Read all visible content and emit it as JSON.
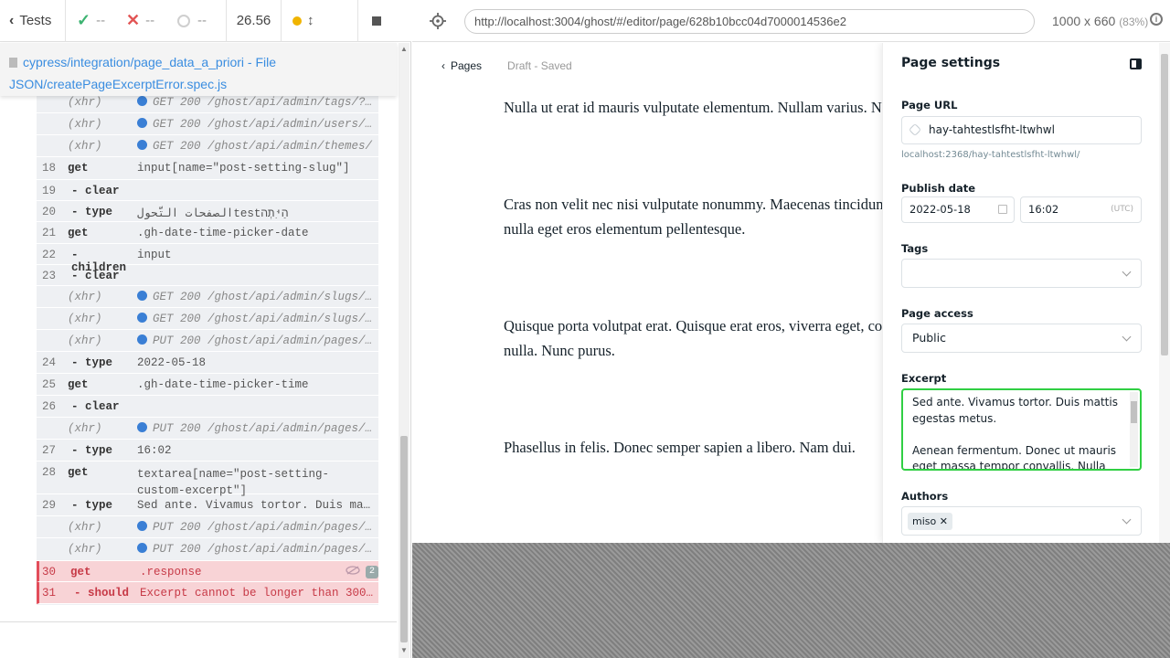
{
  "runner": {
    "tests_label": "Tests",
    "passed": "--",
    "failed": "--",
    "pending": "--",
    "duration": "26.56",
    "spec_path_1": "cypress/integration/page_data_a_priori",
    "spec_sep": " - ",
    "spec_word": "File",
    "spec_path_2": "JSON/createPageExcerptError.spec.js",
    "commands": [
      {
        "type": "xhr",
        "num": "",
        "cmd": "(xhr)",
        "msg": "GET 200 /ghost/api/admin/tags/?..."
      },
      {
        "type": "xhr",
        "num": "",
        "cmd": "(xhr)",
        "msg": "GET 200 /ghost/api/admin/users/..."
      },
      {
        "type": "xhr",
        "num": "",
        "cmd": "(xhr)",
        "msg": "GET 200 /ghost/api/admin/themes/"
      },
      {
        "type": "cmd",
        "num": "18",
        "cmd": "get",
        "msg": "input[name=\"post-setting-slug\"]"
      },
      {
        "type": "child",
        "num": "19",
        "cmd": "- clear",
        "msg": ""
      },
      {
        "type": "child",
        "num": "20",
        "cmd": "- type",
        "msg": "الصفحات التّحولtestהַיִּתְה"
      },
      {
        "type": "cmd",
        "num": "21",
        "cmd": "get",
        "msg": ".gh-date-time-picker-date"
      },
      {
        "type": "child",
        "num": "22",
        "cmd": "- children",
        "msg": "input"
      },
      {
        "type": "child",
        "num": "23",
        "cmd": "- clear",
        "msg": ""
      },
      {
        "type": "xhr",
        "num": "",
        "cmd": "(xhr)",
        "msg": "GET 200 /ghost/api/admin/slugs/..."
      },
      {
        "type": "xhr",
        "num": "",
        "cmd": "(xhr)",
        "msg": "GET 200 /ghost/api/admin/slugs/post/%..."
      },
      {
        "type": "xhr",
        "num": "",
        "cmd": "(xhr)",
        "msg": "PUT 200 /ghost/api/admin/pages/..."
      },
      {
        "type": "child",
        "num": "24",
        "cmd": "- type",
        "msg": "2022-05-18"
      },
      {
        "type": "cmd",
        "num": "25",
        "cmd": "get",
        "msg": ".gh-date-time-picker-time"
      },
      {
        "type": "child",
        "num": "26",
        "cmd": "- clear",
        "msg": ""
      },
      {
        "type": "xhr",
        "num": "",
        "cmd": "(xhr)",
        "msg": "PUT 200 /ghost/api/admin/pages/..."
      },
      {
        "type": "child",
        "num": "27",
        "cmd": "- type",
        "msg": "16:02"
      },
      {
        "type": "cmd",
        "num": "28",
        "cmd": "get",
        "msg": "textarea[name=\"post-setting-custom-excerpt\"]"
      },
      {
        "type": "child",
        "num": "29",
        "cmd": "- type",
        "msg": "Sed ante. Vivamus tortor. Duis mattis ege..."
      },
      {
        "type": "xhr",
        "num": "",
        "cmd": "(xhr)",
        "msg": "PUT 200 /ghost/api/admin/pages/..."
      },
      {
        "type": "xhr",
        "num": "",
        "cmd": "(xhr)",
        "msg": "PUT 200 /ghost/api/admin/pages/..."
      },
      {
        "type": "fail",
        "num": "30",
        "cmd": "get",
        "msg": ".response",
        "badge": "2"
      },
      {
        "type": "fail",
        "num": "31",
        "cmd": "- should",
        "msg": "Excerpt cannot be longer than 300 ..."
      }
    ]
  },
  "aut": {
    "url": "http://localhost:3004/ghost/#/editor/page/628b10bcc04d7000014536e2",
    "viewport": "1000 x 660",
    "zoom": "(83%)"
  },
  "editor": {
    "back_label": "Pages",
    "status": "Draft - Saved",
    "paragraphs": [
      "Nulla ut erat id mauris vulputate elementum. Nullam varius. Nulla",
      "Cras non velit nec nisi vulputate nonummy. Maecenas tincidunt",
      "nulla eget eros elementum pellentesque.",
      "Quisque porta volutpat erat. Quisque erat eros, viverra eget, congue",
      "nulla. Nunc purus.",
      "Phasellus in felis. Donec semper sapien a libero. Nam dui."
    ]
  },
  "settings": {
    "title": "Page settings",
    "url_label": "Page URL",
    "slug": "hay-tahtestlsfht-ltwhwl",
    "url_hint": "localhost:2368/hay-tahtestlsfht-ltwhwl/",
    "publish_label": "Publish date",
    "date": "2022-05-18",
    "time": "16:02",
    "tz": "(UTC)",
    "tags_label": "Tags",
    "access_label": "Page access",
    "access_value": "Public",
    "excerpt_label": "Excerpt",
    "excerpt_text": "Sed ante. Vivamus tortor. Duis mattis egestas metus.\n\nAenean fermentum. Donec ut mauris eget massa tempor convallis. Nulla",
    "authors_label": "Authors",
    "author": "miso"
  }
}
